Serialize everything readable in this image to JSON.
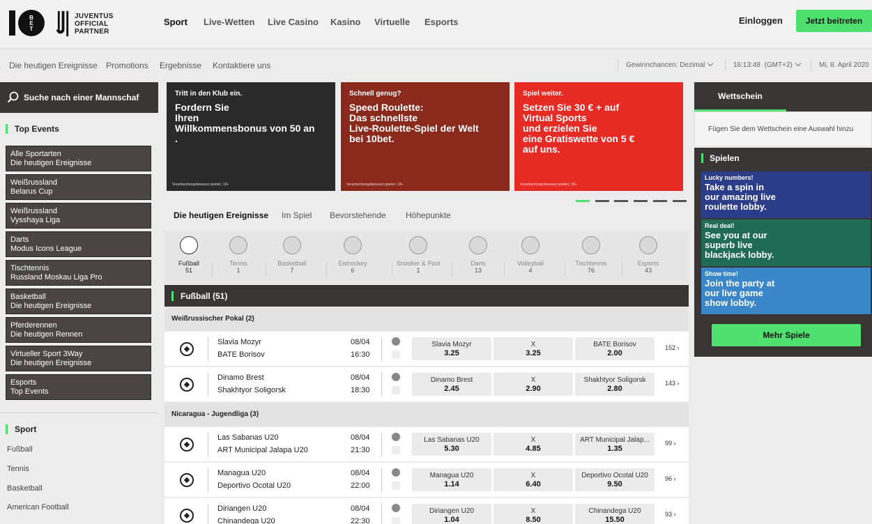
{
  "header": {
    "partner_text": "JUVENTUS\nOFFICIAL\nPARTNER",
    "nav": [
      "Sport",
      "Live-Wetten",
      "Live Casino",
      "Kasino",
      "Virtuelle",
      "Esports"
    ],
    "login": "Einloggen",
    "join": "Jetzt beitreten"
  },
  "subnav": {
    "links": [
      "Die heutigen Ereignisse",
      "Promotions",
      "Ergebnisse",
      "Kontaktiere uns"
    ],
    "odds_label": "Gewinnchancen:",
    "odds_value": "Dezimal",
    "time": "16:13:48",
    "timezone": "(GMT+2)",
    "date": "Mi, 8. April 2020"
  },
  "sidebar": {
    "search_placeholder": "Suche nach einer Mannschaf",
    "top_events_title": "Top Events",
    "top_events": [
      {
        "l1": "Alle Sportarten",
        "l2": "Die heutigen Ereignisse"
      },
      {
        "l1": "Weißrussland",
        "l2": "Belarus Cup"
      },
      {
        "l1": "Weißrussland",
        "l2": "Vysshaya Liga"
      },
      {
        "l1": "Darts",
        "l2": "Modus Icons League"
      },
      {
        "l1": "Tischtennis",
        "l2": "Russland Moskau Liga Pro"
      },
      {
        "l1": "Basketball",
        "l2": "Die heutigen Ereignisse"
      },
      {
        "l1": "Pferderennen",
        "l2": "Die heutigen Rennen"
      },
      {
        "l1": "Virtueller Sport 3Way",
        "l2": "Die heutigen Ereignisse"
      },
      {
        "l1": "Esports",
        "l2": "Top Events"
      }
    ],
    "sport_title": "Sport",
    "sports": [
      "Fußball",
      "Tennis",
      "Basketball",
      "American Football"
    ]
  },
  "banners": [
    {
      "small": "Tritt in den Klub ein.",
      "big": "Fordern Sie\nIhren\nWillkommensbonus von 50 an\n.",
      "foot": "Verantwortungsbewusst spielen; 18+",
      "color": "#2a2a2a"
    },
    {
      "small": "Schnell genug?",
      "big": "Speed Roulette:\nDas schnellste\nLive-Roulette-Spiel der Welt\nbei 10bet.",
      "foot": "Verantwortungsbewusst spielen; 18+",
      "color": "#8a2a1c"
    },
    {
      "small": "Spiel weiter.",
      "big": "Setzen Sie 30 € + auf\nVirtual Sports\nund erzielen Sie\neine Gratiswette von 5 €\nauf uns.",
      "foot": "Verantwortungsbewusst spielen; 18+",
      "color": "#e62a24"
    }
  ],
  "tabs": [
    "Die heutigen Ereignisse",
    "Im Spiel",
    "Bevorstehende",
    "Höhepunkte"
  ],
  "sport_icons": [
    {
      "name": "Fußball",
      "count": "51"
    },
    {
      "name": "Tennis",
      "count": "1"
    },
    {
      "name": "Basketball",
      "count": "7"
    },
    {
      "name": "Eishockey",
      "count": "6"
    },
    {
      "name": "Snooker & Pool",
      "count": "1"
    },
    {
      "name": "Darts",
      "count": "13"
    },
    {
      "name": "Volleyball",
      "count": "4"
    },
    {
      "name": "Tischtennis",
      "count": "76"
    },
    {
      "name": "Esports",
      "count": "43"
    }
  ],
  "section_title": "Fußball  (51)",
  "leagues": [
    {
      "name": "Weißrussischer Pokal  (2)",
      "matches": [
        {
          "home": "Slavia Mozyr",
          "away": "BATE Borisov",
          "date": "08/04",
          "time": "16:30",
          "o1n": "Slavia Mozyr",
          "o1": "3.25",
          "oxn": "X",
          "ox": "3.25",
          "o2n": "BATE Borisov",
          "o2": "2.00",
          "more": "152"
        },
        {
          "home": "Dinamo Brest",
          "away": "Shakhtyor Soligorsk",
          "date": "08/04",
          "time": "18:30",
          "o1n": "Dinamo Brest",
          "o1": "2.45",
          "oxn": "X",
          "ox": "2.90",
          "o2n": "Shakhtyor Soligorsk",
          "o2": "2.80",
          "more": "143"
        }
      ]
    },
    {
      "name": "Nicaragua - Jugendliga  (3)",
      "matches": [
        {
          "home": "Las Sabanas U20",
          "away": "ART Municipal Jalapa U20",
          "date": "08/04",
          "time": "21:30",
          "o1n": "Las Sabanas U20",
          "o1": "5.30",
          "oxn": "X",
          "ox": "4.85",
          "o2n": "ART Municipal Jalap...",
          "o2": "1.35",
          "more": "99"
        },
        {
          "home": "Managua U20",
          "away": "Deportivo Ocotal U20",
          "date": "08/04",
          "time": "22:00",
          "o1n": "Managua U20",
          "o1": "1.14",
          "oxn": "X",
          "ox": "6.40",
          "o2n": "Deportivo Ocotal U20",
          "o2": "9.50",
          "more": "96"
        },
        {
          "home": "Diriangen U20",
          "away": "Chinandega U20",
          "date": "08/04",
          "time": "22:30",
          "o1n": "Diriangen U20",
          "o1": "1.04",
          "oxn": "X",
          "ox": "8.50",
          "o2n": "Chinandega U20",
          "o2": "15.50",
          "more": "93"
        }
      ]
    }
  ],
  "betslip": {
    "title": "Wettschein",
    "empty": "Fügen Sie dem Wettschein eine Auswahl hinzu"
  },
  "games": {
    "title": "Spielen",
    "items": [
      {
        "s": "Lucky numbers!",
        "b": "Take a spin in\nour amazing live\nroulette lobby.",
        "color": "#2c3d8a"
      },
      {
        "s": "Real deal!",
        "b": "See you at our\nsuperb live\nblackjack lobby.",
        "color": "#1f6b54"
      },
      {
        "s": "Show time!",
        "b": "Join the party at\nour live game\nshow lobby.",
        "color": "#3a86c8"
      }
    ],
    "more": "Mehr Spiele"
  },
  "colors": {
    "accent": "#4fe06f",
    "dark": "#3a3535"
  }
}
